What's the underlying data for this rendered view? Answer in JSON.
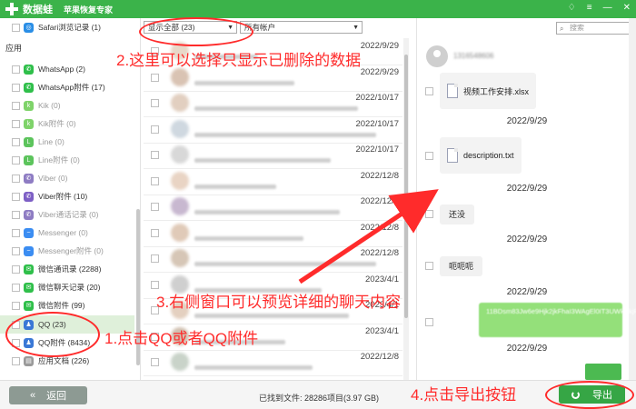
{
  "titlebar": {
    "app_name": "数据蛙",
    "subtitle": "苹果恢复专家",
    "controls": [
      "♢",
      "≡",
      "—",
      "✕"
    ]
  },
  "sidebar": {
    "section_label": "应用",
    "items": [
      {
        "label": "Safari浏览记录 (1)",
        "color": "#2a8ee6",
        "glyph": "◎",
        "dim": false
      },
      {
        "label": "WhatsApp (2)",
        "color": "#2fbf4a",
        "glyph": "✆",
        "dim": false
      },
      {
        "label": "WhatsApp附件 (17)",
        "color": "#2fbf4a",
        "glyph": "✆",
        "dim": false
      },
      {
        "label": "Kik (0)",
        "color": "#7fd36a",
        "glyph": "k",
        "dim": true
      },
      {
        "label": "Kik附件 (0)",
        "color": "#7fd36a",
        "glyph": "k",
        "dim": true
      },
      {
        "label": "Line (0)",
        "color": "#5cc45c",
        "glyph": "L",
        "dim": true
      },
      {
        "label": "Line附件 (0)",
        "color": "#5cc45c",
        "glyph": "L",
        "dim": true
      },
      {
        "label": "Viber (0)",
        "color": "#8e7cc3",
        "glyph": "✆",
        "dim": true
      },
      {
        "label": "Viber附件 (10)",
        "color": "#7d5fc5",
        "glyph": "✆",
        "dim": false
      },
      {
        "label": "Viber通话记录 (0)",
        "color": "#8e7cc3",
        "glyph": "✆",
        "dim": true
      },
      {
        "label": "Messenger (0)",
        "color": "#3b8df2",
        "glyph": "~",
        "dim": true
      },
      {
        "label": "Messenger附件 (0)",
        "color": "#3b8df2",
        "glyph": "~",
        "dim": true
      },
      {
        "label": "微信通讯录 (2288)",
        "color": "#2fbf4a",
        "glyph": "✉",
        "dim": false
      },
      {
        "label": "微信聊天记录 (20)",
        "color": "#2fbf4a",
        "glyph": "✉",
        "dim": false
      },
      {
        "label": "微信附件 (99)",
        "color": "#2fbf4a",
        "glyph": "✉",
        "dim": false
      },
      {
        "label": "QQ (23)",
        "color": "#3a78d6",
        "glyph": "♟",
        "dim": false,
        "active": true
      },
      {
        "label": "QQ附件 (8434)",
        "color": "#3a78d6",
        "glyph": "♟",
        "dim": false
      },
      {
        "label": "应用文档 (226)",
        "color": "#9a9a9a",
        "glyph": "▤",
        "dim": false
      }
    ]
  },
  "filter": {
    "selected": "显示全部 (23)",
    "account": "所有帐户"
  },
  "list": {
    "dates": [
      "2022/9/29",
      "2022/9/29",
      "2022/10/17",
      "2022/10/17",
      "2022/10/17",
      "2022/12/8",
      "2022/12/8",
      "2022/12/8",
      "2022/12/8",
      "2023/4/1",
      "2023/4/1",
      "2023/4/1",
      "2022/12/8"
    ]
  },
  "preview": {
    "search_placeholder": "搜索",
    "contact_name": "1316548606",
    "messages": [
      {
        "kind": "file",
        "name": "视频工作安排.xlsx",
        "date": "2022/9/29"
      },
      {
        "kind": "file",
        "name": "description.txt",
        "date": "2022/9/29"
      },
      {
        "kind": "text",
        "text": "还没",
        "date": "2022/9/29"
      },
      {
        "kind": "text",
        "text": "呃呃呃",
        "date": "2022/9/29"
      },
      {
        "kind": "sent",
        "text": "11BDsm83Jw6e9Hjk2jkFhaI3WAgEl0IT3UWkRkjRoG0",
        "date": "2022/9/29"
      }
    ]
  },
  "bottom": {
    "back_label": "返回",
    "back_arrow": "«",
    "found_text": "已找到文件: 28286项目(3.97 GB)",
    "export_label": "导出"
  },
  "annotations": {
    "a1": "1.点击QQ或者QQ附件",
    "a2": "2.这里可以选择只显示已删除的数据",
    "a3": "3.右侧窗口可以预览详细的聊天内容",
    "a4": "4.点击导出按钮",
    "color": "#ff2b2b"
  }
}
